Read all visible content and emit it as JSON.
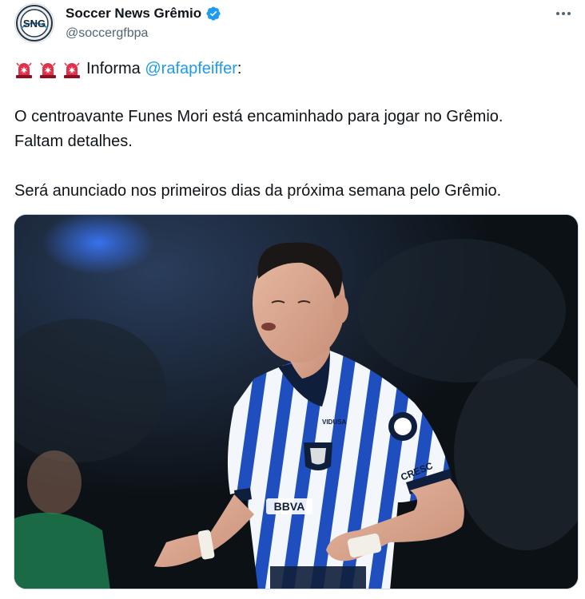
{
  "tweet": {
    "author": {
      "display_name": "Soccer News Grêmio",
      "handle": "@soccergfbpa",
      "verified": true,
      "avatar_text": "SNG",
      "avatar_icon": "sng-logo"
    },
    "more_icon": "more-horizontal-icon",
    "intro": {
      "prefix": "Informa ",
      "mention": "@rafapfeiffer",
      "suffix": ":"
    },
    "emoji_icon": "police-car-light",
    "paragraph_2": {
      "line_1": "O centroavante Funes Mori está encaminhado para jogar no Grêmio.",
      "line_2": "Faltam detalhes."
    },
    "paragraph_3": "Será anunciado nos primeiros dias da próxima semana pelo Grêmio.",
    "media": {
      "kind": "photo",
      "jersey_texts": [
        "BBVA",
        "CRESC",
        "VIDUSA"
      ]
    }
  },
  "colors": {
    "text": "#0f1419",
    "secondary": "#536471",
    "accent": "#1d9bf0",
    "siren_red": "#e0304a"
  }
}
